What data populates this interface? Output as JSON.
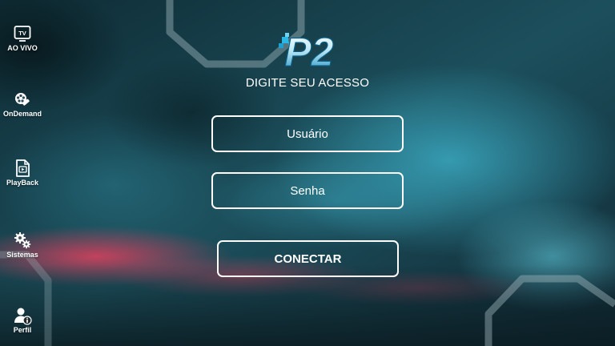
{
  "app": {
    "brand_text": "P2",
    "accent_color": "#2bb8e6"
  },
  "sidebar": {
    "items": [
      {
        "label": "AO VIVO",
        "icon": "tv-icon",
        "icon_text": "TV"
      },
      {
        "label": "OnDemand",
        "icon": "film-reel-icon"
      },
      {
        "label": "PlayBack",
        "icon": "playback-file-icon"
      },
      {
        "label": "Sistemas",
        "icon": "gears-icon"
      },
      {
        "label": "Perfil",
        "icon": "user-info-icon"
      }
    ]
  },
  "login": {
    "headline": "DIGITE SEU ACESSO",
    "username_placeholder": "Usuário",
    "username_value": "",
    "password_placeholder": "Senha",
    "password_value": "",
    "connect_label": "CONECTAR"
  }
}
